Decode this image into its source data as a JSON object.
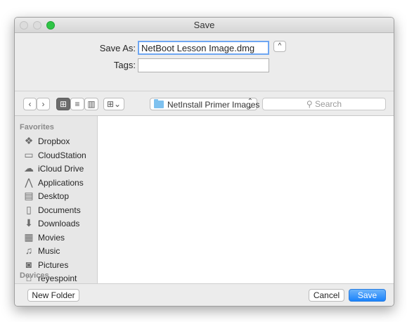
{
  "window": {
    "title": "Save"
  },
  "form": {
    "save_as_label": "Save As:",
    "filename_value": "NetBoot Lesson Image.dmg",
    "tags_label": "Tags:",
    "tags_value": "",
    "expand_glyph": "^"
  },
  "toolbar": {
    "back_glyph": "‹",
    "forward_glyph": "›",
    "location": "NetInstall Primer Images",
    "location_arrows": "⌃⌄",
    "search_placeholder": "Search",
    "search_glyph": "⚲",
    "view_group_icon": "group-by-icon"
  },
  "sidebar": {
    "favorites_heading": "Favorites",
    "devices_heading": "Devices",
    "items": [
      {
        "label": "Dropbox",
        "icon": "dropbox-icon",
        "glyph": "❖"
      },
      {
        "label": "CloudStation",
        "icon": "folder-icon",
        "glyph": "▭"
      },
      {
        "label": "iCloud Drive",
        "icon": "cloud-icon",
        "glyph": "☁"
      },
      {
        "label": "Applications",
        "icon": "applications-icon",
        "glyph": "⋀"
      },
      {
        "label": "Desktop",
        "icon": "desktop-icon",
        "glyph": "▤"
      },
      {
        "label": "Documents",
        "icon": "documents-icon",
        "glyph": "▯"
      },
      {
        "label": "Downloads",
        "icon": "downloads-icon",
        "glyph": "⬇"
      },
      {
        "label": "Movies",
        "icon": "movies-icon",
        "glyph": "▦"
      },
      {
        "label": "Music",
        "icon": "music-icon",
        "glyph": "♫"
      },
      {
        "label": "Pictures",
        "icon": "pictures-icon",
        "glyph": "◙"
      },
      {
        "label": "reyespoint",
        "icon": "home-icon",
        "glyph": "⌂"
      }
    ]
  },
  "bottom": {
    "new_folder": "New Folder",
    "cancel": "Cancel",
    "save": "Save"
  },
  "colors": {
    "accent": "#1a82fb",
    "window_bg": "#ececec",
    "zoom_green": "#2fc546"
  }
}
